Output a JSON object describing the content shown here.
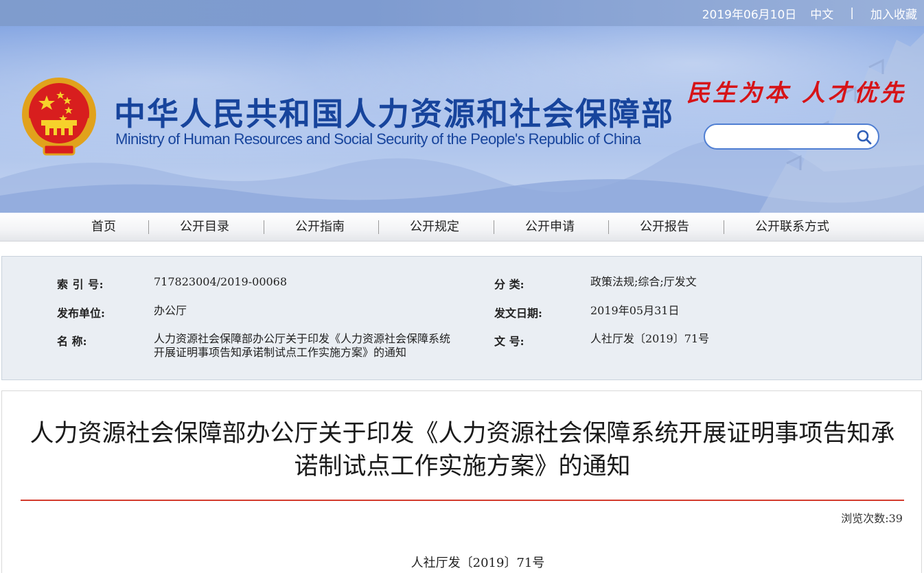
{
  "topbar": {
    "date": "2019年06月10日",
    "lang_label": "中文",
    "separator": "|",
    "bookmark_label": "加入收藏"
  },
  "banner": {
    "title_cn": "中华人民共和国人力资源和社会保障部",
    "title_en": "Ministry of Human Resources and Social Security of the People's Republic of China",
    "slogan": "民生为本 人才优先",
    "search_placeholder": ""
  },
  "nav": {
    "items": [
      {
        "label": "首页"
      },
      {
        "label": "公开目录"
      },
      {
        "label": "公开指南"
      },
      {
        "label": "公开规定"
      },
      {
        "label": "公开申请"
      },
      {
        "label": "公开报告"
      },
      {
        "label": "公开联系方式"
      }
    ]
  },
  "info": {
    "index_label": "索  引  号:",
    "index_value": "717823004/2019-00068",
    "category_label": "分      类:",
    "category_value": "政策法规;综合;厅发文",
    "publisher_label": "发布单位:",
    "publisher_value": "办公厅",
    "date_label": "发文日期:",
    "date_value": "2019年05月31日",
    "name_label": "名      称:",
    "name_value": "人力资源社会保障部办公厅关于印发《人力资源社会保障系统开展证明事项告知承诺制试点工作实施方案》的通知",
    "docno_label": "文      号:",
    "docno_value": "人社厅发〔2019〕71号"
  },
  "article": {
    "title": "人力资源社会保障部办公厅关于印发《人力资源社会保障系统开展证明事项告知承诺制试点工作实施方案》的通知",
    "view_count_label": "浏览次数:39",
    "doc_number": "人社厅发〔2019〕71号"
  },
  "colors": {
    "brand_blue": "#17449c",
    "slogan_red": "#d61418",
    "rule_red": "#d33a2c"
  }
}
